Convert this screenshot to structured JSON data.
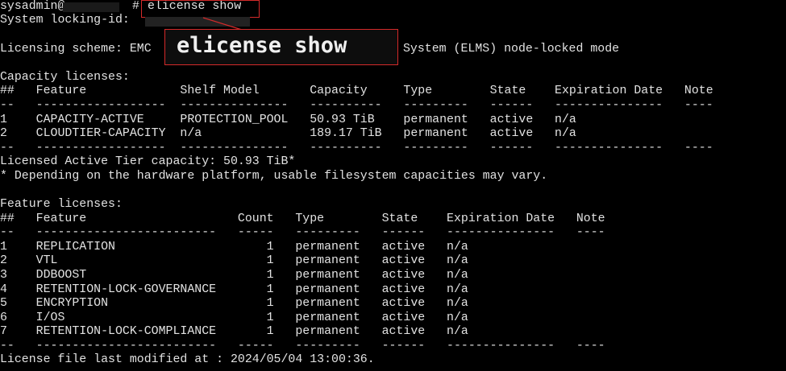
{
  "prompt_line": {
    "user": "sysadmin@",
    "hash": "#",
    "command": "elicense show"
  },
  "locking_id_label": "System locking-id:",
  "licensing_scheme": {
    "prefix": "Licensing scheme: EMC",
    "suffix": "System (ELMS) node-locked mode"
  },
  "callout_text": "elicense show",
  "capacity": {
    "title": "Capacity licenses:",
    "header": "##   Feature             Shelf Model       Capacity     Type        State    Expiration Date   Note",
    "divider": "--   ------------------  ---------------   ----------   ---------   ------   ---------------   ----",
    "rows": [
      "1    CAPACITY-ACTIVE     PROTECTION_POOL   50.93 TiB    permanent   active   n/a",
      "2    CLOUDTIER-CAPACITY  n/a               189.17 TiB   permanent   active   n/a"
    ],
    "footer_divider": "--   ------------------  ---------------   ----------   ---------   ------   ---------------   ----",
    "licensed_active": "Licensed Active Tier capacity: 50.93 TiB*",
    "note": "* Depending on the hardware platform, usable filesystem capacities may vary."
  },
  "feature": {
    "title": "Feature licenses:",
    "header": "##   Feature                     Count   Type        State    Expiration Date   Note",
    "divider": "--   -------------------------   -----   ---------   ------   ---------------   ----",
    "rows": [
      "1    REPLICATION                     1   permanent   active   n/a",
      "2    VTL                             1   permanent   active   n/a",
      "3    DDBOOST                         1   permanent   active   n/a",
      "4    RETENTION-LOCK-GOVERNANCE       1   permanent   active   n/a",
      "5    ENCRYPTION                      1   permanent   active   n/a",
      "6    I/OS                            1   permanent   active   n/a",
      "7    RETENTION-LOCK-COMPLIANCE       1   permanent   active   n/a"
    ],
    "footer_divider": "--   -------------------------   -----   ---------   ------   ---------------   ----"
  },
  "last_modified": "License file last modified at : 2024/05/04 13:00:36.",
  "colors": {
    "background": "#000000",
    "text": "#e2e2e2",
    "highlight_border": "#d42a2a"
  }
}
